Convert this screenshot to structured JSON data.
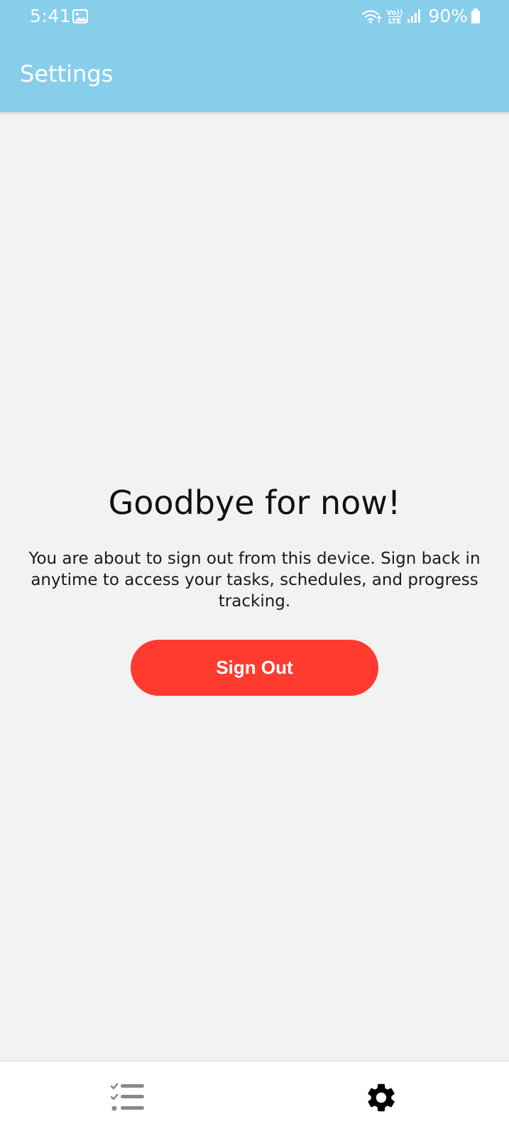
{
  "status_bar": {
    "time": "5:41",
    "battery": "90%",
    "icons": [
      "gallery-icon",
      "wifi-icon",
      "volte-icon",
      "signal-icon",
      "battery-icon"
    ],
    "network_label": "VoLTE"
  },
  "app_bar": {
    "title": "Settings",
    "color": "#87ceeb"
  },
  "main": {
    "headline": "Goodbye for now!",
    "message": "You are about to sign out from this device. Sign back in anytime to access your tasks, schedules, and progress tracking.",
    "signout_label": "Sign Out",
    "signout_color": "#ff3b30"
  },
  "bottom_nav": {
    "items": [
      {
        "name": "tasks",
        "icon": "checklist-icon",
        "active": false
      },
      {
        "name": "settings",
        "icon": "gear-icon",
        "active": true
      }
    ]
  }
}
